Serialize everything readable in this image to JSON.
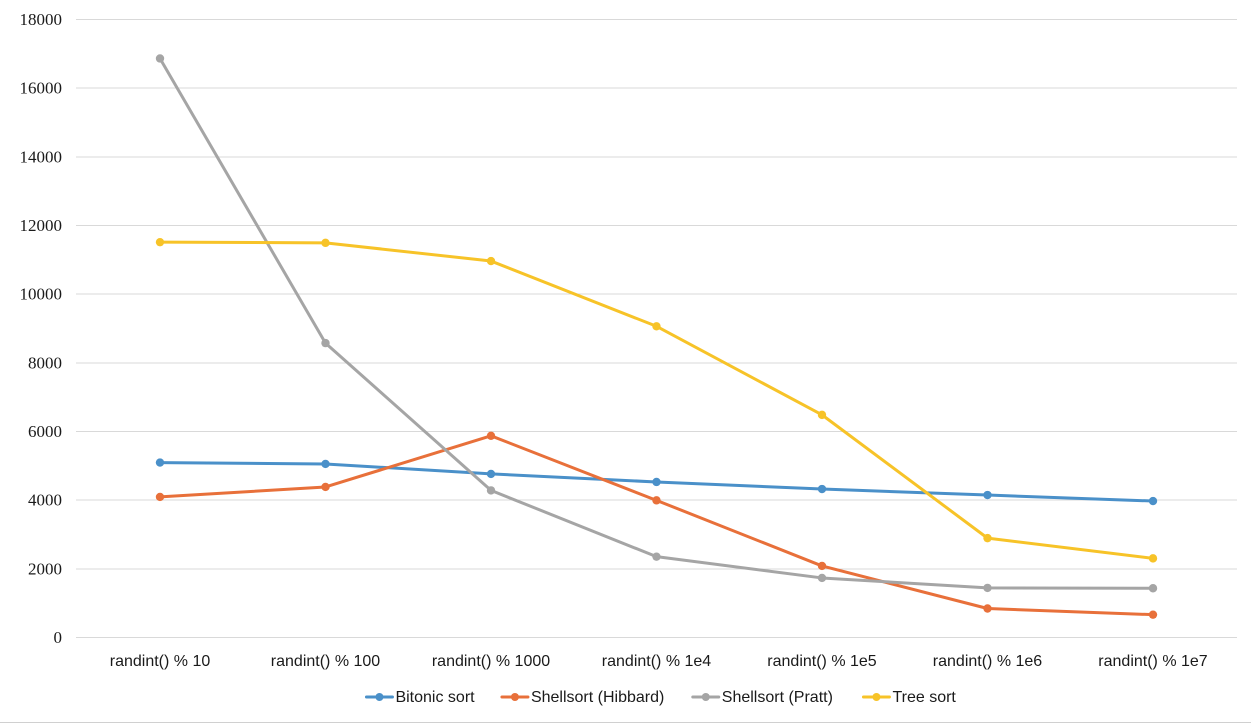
{
  "chart_data": {
    "type": "line",
    "title": "",
    "subtitle": "",
    "xlabel": "",
    "ylabel": "",
    "categories": [
      "randint() % 10",
      "randint() % 100",
      "randint() % 1000",
      "randint() % 1e4",
      "randint() % 1e5",
      "randint() % 1e6",
      "randint() % 1e7"
    ],
    "yticks": [
      0,
      2000,
      4000,
      6000,
      8000,
      10000,
      12000,
      14000,
      16000,
      18000
    ],
    "ytick_labels": [
      "0",
      "2000",
      "4000",
      "6000",
      "8000",
      "10000",
      "12000",
      "14000",
      "16000",
      "18000"
    ],
    "ylim": [
      0,
      18000
    ],
    "grid": "horizontal",
    "legend_position": "bottom",
    "series": [
      {
        "name": "Bitonic sort",
        "color": "#4a90c9",
        "values": [
          5080,
          5040,
          4750,
          4515,
          4310,
          4135,
          3960
        ]
      },
      {
        "name": "Shellsort (Hibbard)",
        "color": "#e8703a",
        "values": [
          4080,
          4370,
          5860,
          3980,
          2070,
          830,
          650
        ]
      },
      {
        "name": "Shellsort (Pratt)",
        "color": "#a5a5a5",
        "values": [
          16850,
          8560,
          4270,
          2340,
          1720,
          1430,
          1420
        ]
      },
      {
        "name": "Tree sort",
        "color": "#f7c328",
        "values": [
          11500,
          11480,
          10950,
          9050,
          6470,
          2880,
          2290
        ]
      }
    ]
  },
  "colors": {
    "gridline": "#d9d9d9",
    "axis_text": "#1a1a1a",
    "background": "#ffffff",
    "series_1": "#4a90c9",
    "series_2": "#e8703a",
    "series_3": "#a5a5a5",
    "series_4": "#f7c328"
  }
}
